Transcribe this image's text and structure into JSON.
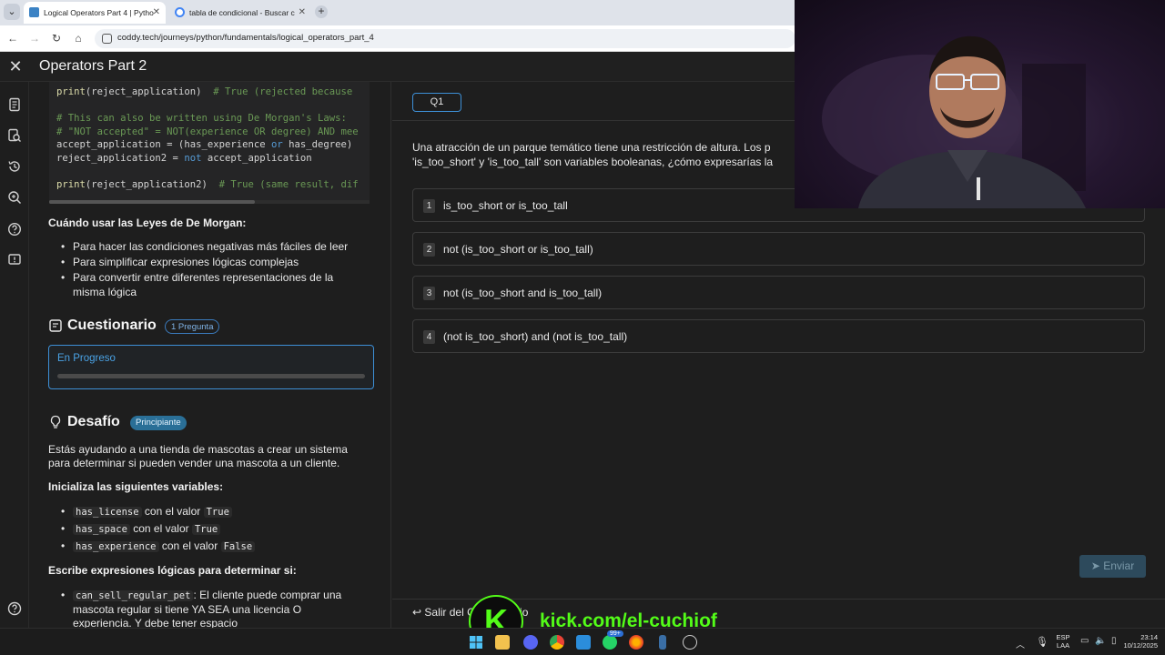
{
  "browser": {
    "tabs": [
      {
        "title": "Logical Operators Part 4 | Pytho",
        "active": true
      },
      {
        "title": "tabla de condicional - Buscar c",
        "active": false
      }
    ],
    "url": "coddy.tech/journeys/python/fundamentals/logical_operators_part_4"
  },
  "header": {
    "title": "Operators Part 2"
  },
  "code": {
    "lines": [
      "print(reject_application)  # True (rejected because",
      "",
      "# This can also be written using De Morgan's Laws:",
      "# \"NOT accepted\" = NOT(experience OR degree) AND mee",
      "accept_application = (has_experience or has_degree)",
      "reject_application2 = not accept_application",
      "",
      "print(reject_application2)  # True (same result, dif"
    ]
  },
  "lesson": {
    "when_heading": "Cuándo usar las Leyes de De Morgan:",
    "when_items": [
      "Para hacer las condiciones negativas más fáciles de leer",
      "Para simplificar expresiones lógicas complejas",
      "Para convertir entre diferentes representaciones de la",
      "misma lógica"
    ]
  },
  "quiz": {
    "title": "Cuestionario",
    "badge": "1 Pregunta",
    "status": "En Progreso"
  },
  "challenge": {
    "title": "Desafío",
    "badge": "Principiante",
    "intro_1": "Estás ayudando a una tienda de mascotas a crear un sistema",
    "intro_2": "para determinar si pueden vender una mascota a un cliente.",
    "init_heading": "Inicializa las siguientes variables:",
    "vars": [
      {
        "name": "has_license",
        "mid": "con el valor",
        "value": "True"
      },
      {
        "name": "has_space",
        "mid": "con el valor",
        "value": "True"
      },
      {
        "name": "has_experience",
        "mid": "con el valor",
        "value": "False"
      }
    ],
    "write_heading": "Escribe expresiones lógicas para determinar si:",
    "rule_var": "can_sell_regular_pet",
    "rule_text_1": ": El cliente puede comprar una",
    "rule_text_2": "mascota regular si tiene YA SEA una licencia O",
    "rule_text_3": "experiencia. Y debe tener espacio"
  },
  "question": {
    "tab": "Q1",
    "text_1": "Una atracción de un parque temático tiene una restricción de altura. Los p",
    "text_2": "'is_too_short' y 'is_too_tall' son variables booleanas, ¿cómo expresarías la",
    "options": [
      {
        "num": "1",
        "text": "is_too_short or is_too_tall"
      },
      {
        "num": "2",
        "text": "not (is_too_short or is_too_tall)"
      },
      {
        "num": "3",
        "text": "not (is_too_short and is_too_tall)"
      },
      {
        "num": "4",
        "text": "(not is_too_short) and (not is_too_tall)"
      }
    ],
    "submit": "Enviar",
    "exit": "Salir del Cuestionario"
  },
  "overlay": {
    "kick_letter": "K",
    "kick_url": "kick.com/el-cuchiof"
  },
  "taskbar": {
    "lang_1": "ESP",
    "lang_2": "LAA",
    "time": "23:14",
    "date": "10/12/2025",
    "badge": "99+"
  },
  "colors": {
    "accent": "#3d8fd6",
    "kick": "#53fc18"
  }
}
